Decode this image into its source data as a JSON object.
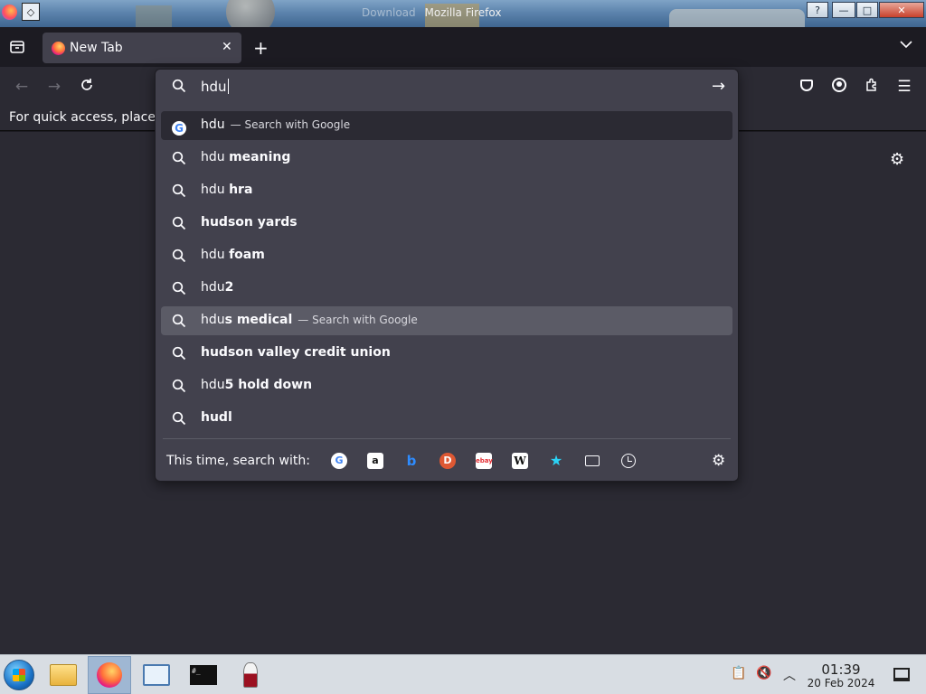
{
  "window": {
    "title": "Mozilla Firefox",
    "background_ghost_title": "Download",
    "buttons": {
      "help": "?",
      "minimize": "—",
      "maximize": "□",
      "close": "✕"
    }
  },
  "tabs": [
    {
      "label": "New Tab",
      "active": true
    }
  ],
  "toolbar": {
    "new_tab_label": "+",
    "icons": [
      "back-icon",
      "forward-icon",
      "reload-icon",
      "pocket-icon",
      "account-icon",
      "extensions-icon",
      "menu-icon"
    ]
  },
  "bookmarks_bar": {
    "message": "For quick access, place y"
  },
  "urlbar": {
    "value": "hdu",
    "results": [
      {
        "typed": "hdu",
        "completion": "",
        "action": "— Search with Google",
        "icon": "google-icon"
      },
      {
        "typed": "hdu ",
        "completion": "meaning",
        "action": "",
        "icon": "search-icon"
      },
      {
        "typed": "hdu ",
        "completion": "hra",
        "action": "",
        "icon": "search-icon"
      },
      {
        "typed": "",
        "completion": "hudson yards",
        "action": "",
        "icon": "search-icon"
      },
      {
        "typed": "hdu ",
        "completion": "foam",
        "action": "",
        "icon": "search-icon"
      },
      {
        "typed": "hdu",
        "completion": "2",
        "action": "",
        "icon": "search-icon"
      },
      {
        "typed": "hdu",
        "completion": "s medical",
        "action": "— Search with Google",
        "icon": "search-icon",
        "selected": true
      },
      {
        "typed": "",
        "completion": "hudson valley credit union",
        "action": "",
        "icon": "search-icon"
      },
      {
        "typed": "hdu",
        "completion": "5 hold down",
        "action": "",
        "icon": "search-icon"
      },
      {
        "typed": "",
        "completion": "hudl",
        "action": "",
        "icon": "search-icon"
      }
    ],
    "one_off_label": "This time, search with:",
    "engines": [
      {
        "name": "Google",
        "glyph": "G"
      },
      {
        "name": "Amazon",
        "glyph": "a"
      },
      {
        "name": "Bing",
        "glyph": "b"
      },
      {
        "name": "DuckDuckGo",
        "glyph": "D"
      },
      {
        "name": "eBay",
        "glyph": "ebay"
      },
      {
        "name": "Wikipedia",
        "glyph": "W"
      },
      {
        "name": "Bookmarks",
        "glyph": "★"
      },
      {
        "name": "Tabs",
        "glyph": ""
      },
      {
        "name": "History",
        "glyph": ""
      }
    ]
  },
  "taskbar": {
    "apps": [
      "file-manager-icon",
      "firefox-icon",
      "settings-icon",
      "terminal-icon",
      "wine-icon"
    ],
    "terminal_glyph": "#_",
    "clock": {
      "time": "01:39",
      "date": "20 Feb 2024"
    }
  },
  "colors": {
    "frame": "#1c1b22",
    "toolbar": "#2b2a33",
    "popup": "#42414d",
    "selected_row": "#5b5b66"
  }
}
